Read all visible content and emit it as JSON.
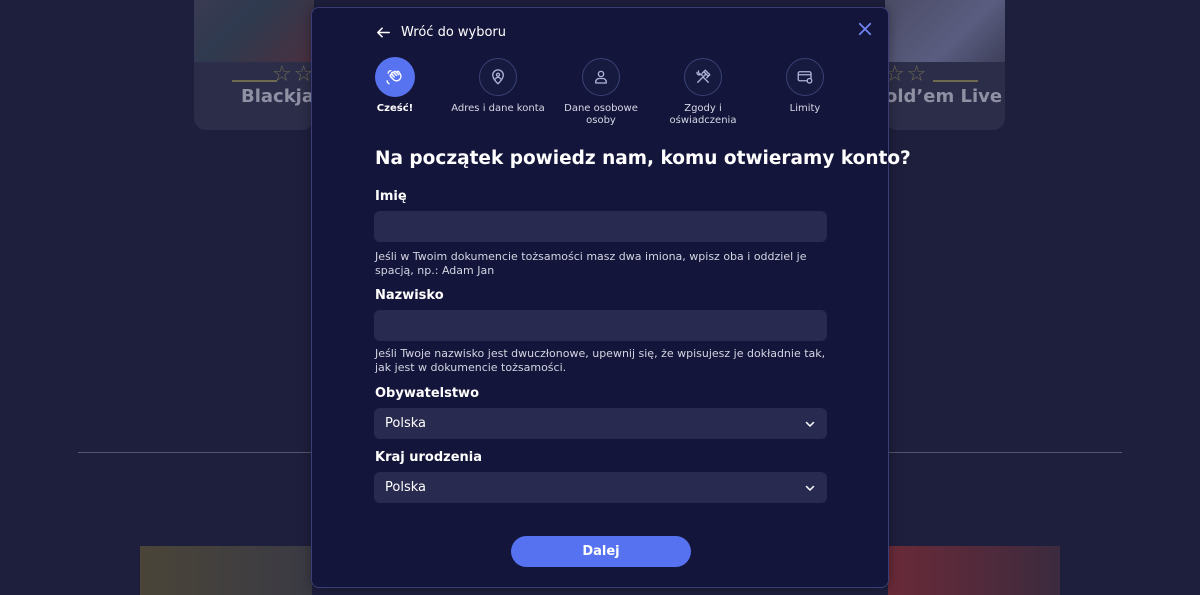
{
  "background": {
    "cards": [
      {
        "title": "Blackjac"
      },
      {
        "title": "old’em Live"
      }
    ]
  },
  "modal": {
    "back_label": "Wróć do wyboru",
    "steps": [
      {
        "label": "Cześć!",
        "icon": "wave-hand-icon",
        "active": true
      },
      {
        "label": "Adres i dane konta",
        "icon": "location-pin-icon",
        "active": false
      },
      {
        "label": "Dane osobowe osoby",
        "icon": "person-icon",
        "active": false
      },
      {
        "label": "Zgody i oświadczenia",
        "icon": "hammer-wrench-icon",
        "active": false
      },
      {
        "label": "Limity",
        "icon": "card-settings-icon",
        "active": false
      }
    ],
    "heading": "Na początek powiedz nam, komu otwieramy konto?",
    "fields": {
      "first_name": {
        "label": "Imię",
        "value": "",
        "hint": "Jeśli w Twoim dokumencie tożsamości masz dwa imiona, wpisz oba i oddziel je spacją, np.: Adam Jan"
      },
      "last_name": {
        "label": "Nazwisko",
        "value": "",
        "hint": "Jeśli Twoje nazwisko jest dwuczłonowe, upewnij się, że wpisujesz je dokładnie tak, jak jest w dokumencie tożsamości."
      },
      "citizenship": {
        "label": "Obywatelstwo",
        "value": "Polska"
      },
      "birth_country": {
        "label": "Kraj urodzenia",
        "value": "Polska"
      }
    },
    "next_label": "Dalej"
  },
  "colors": {
    "page_bg": "#1e1f3d",
    "modal_bg": "#14153a",
    "accent": "#5672f0",
    "input_bg": "#282a4f"
  }
}
